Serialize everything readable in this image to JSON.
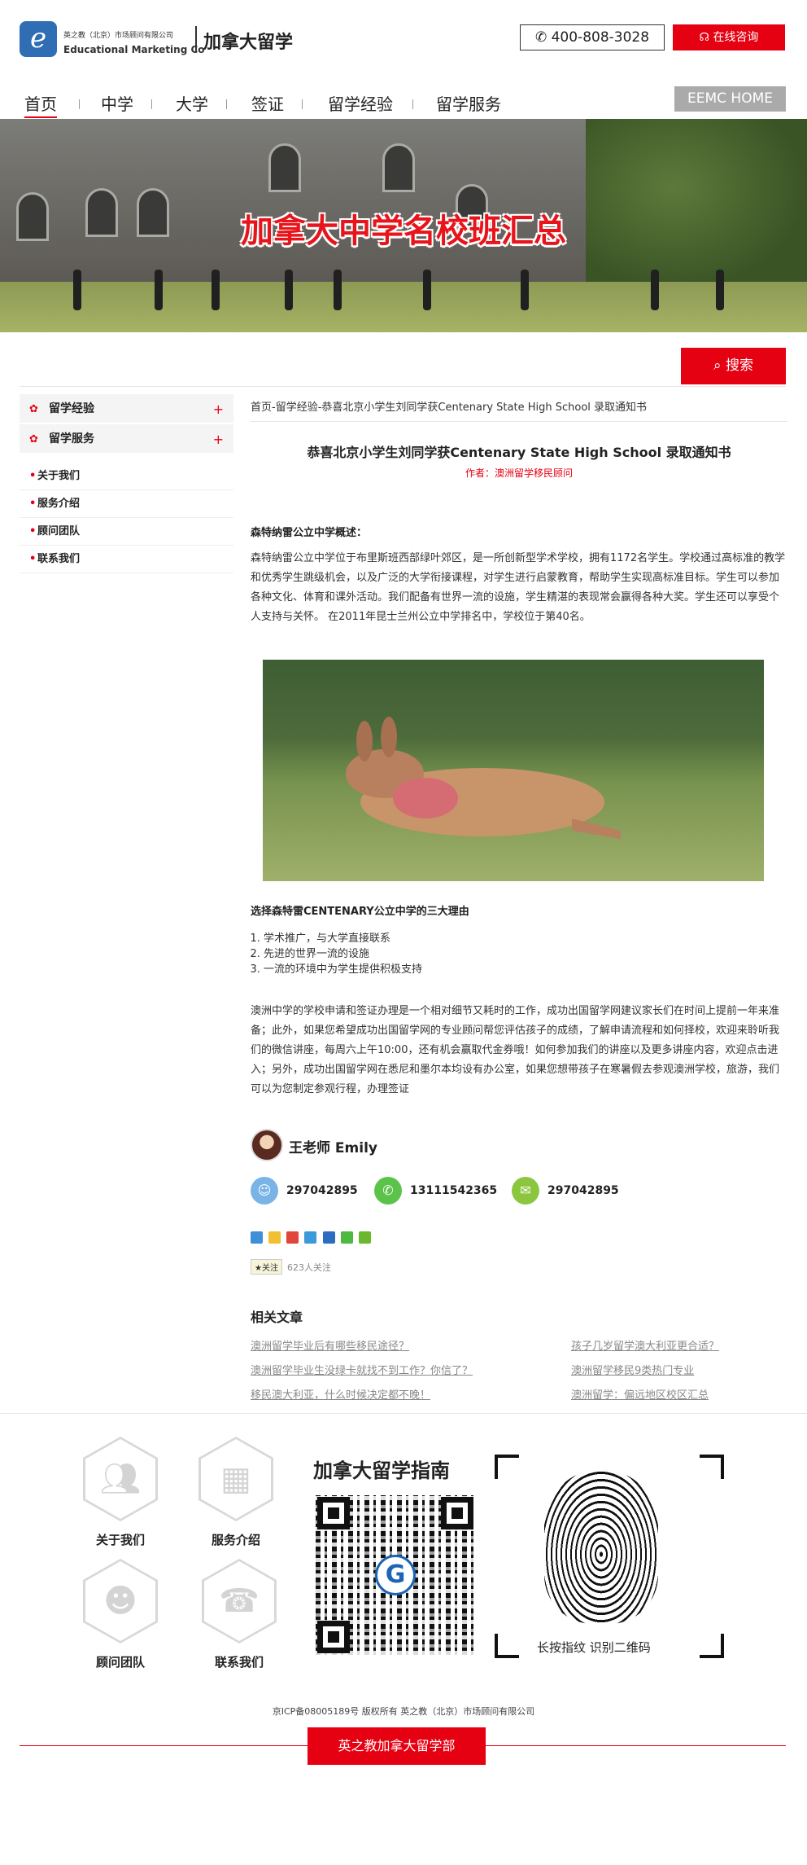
{
  "header": {
    "company_cn": "英之教（北京）市场顾问有限公司",
    "company_en": "Educational Marketing Co",
    "site_title": "加拿大留学",
    "phone": "400-808-3028",
    "consult_label": "在线咨询",
    "logo_letter": "e"
  },
  "nav": {
    "items": [
      "首页",
      "中学",
      "大学",
      "签证",
      "留学经验",
      "留学服务"
    ],
    "active_index": 0,
    "home_label": "EEMC HOME"
  },
  "banner": {
    "title": "加拿大中学名校班汇总"
  },
  "search": {
    "button_label": "搜索"
  },
  "sidebar": {
    "sections": [
      {
        "label": "留学经验",
        "expand": "+"
      },
      {
        "label": "留学服务",
        "expand": "+"
      }
    ],
    "links": [
      "关于我们",
      "服务介绍",
      "顾问团队",
      "联系我们"
    ]
  },
  "article": {
    "breadcrumb": "首页-留学经验-恭喜北京小学生刘同学获Centenary State High School 录取通知书",
    "title": "恭喜北京小学生刘同学获Centenary State High School 录取通知书",
    "author": "作者：澳洲留学移民顾问",
    "overview_heading": "森特纳雷公立中学概述：",
    "overview_text": "森特纳雷公立中学位于布里斯班西部绿叶郊区，是一所创新型学术学校，拥有1172名学生。学校通过高标准的教学和优秀学生跳级机会，以及广泛的大学衔接课程，对学生进行启蒙教育，帮助学生实现高标准目标。学生可以参加各种文化、体育和课外活动。我们配备有世界一流的设施，学生精湛的表现常会赢得各种大奖。学生还可以享受个人支持与关怀。 在2011年昆士兰州公立中学排名中，学校位于第40名。",
    "reasons_heading": "选择森特雷CENTENARY公立中学的三大理由",
    "reasons": [
      "学术推广，与大学直接联系",
      "先进的世界一流的设施",
      "一流的环境中为学生提供积极支持"
    ],
    "closing_text": "澳洲中学的学校申请和签证办理是一个相对细节又耗时的工作，成功出国留学网建议家长们在时间上提前一年来准备；此外，如果您希望成功出国留学网的专业顾问帮您评估孩子的成绩，了解申请流程和如何择校，欢迎来聆听我们的微信讲座，每周六上午10:00，还有机会赢取代金券哦！如何参加我们的讲座以及更多讲座内容，欢迎点击进入；另外，成功出国留学网在悉尼和墨尔本均设有办公室，如果您想带孩子在寒暑假去参观澳洲学校，旅游，我们可以为您制定参观行程，办理签证"
  },
  "teacher": {
    "name": "王老师 Emily",
    "qq": "297042895",
    "whatsapp": "13111542365",
    "wechat": "297042895"
  },
  "follow": {
    "button_label": "关注",
    "count_text": "623人关注"
  },
  "related": {
    "heading": "相关文章",
    "left": [
      "澳洲留学毕业后有哪些移民途径？",
      "澳洲留学毕业生没绿卡就找不到工作？你信了？",
      "移民澳大利亚，什么时候决定都不晚！"
    ],
    "right": [
      "孩子几岁留学澳大利亚更合适？",
      "澳洲留学移民9类热门专业",
      "澳洲留学：偏远地区校区汇总"
    ]
  },
  "footer": {
    "tiles": [
      "关于我们",
      "服务介绍",
      "顾问团队",
      "联系我们"
    ],
    "guide_title": "加拿大留学指南",
    "fingerprint_label": "长按指纹 识别二维码",
    "qr_logo_letter": "G",
    "icp": "京ICP备08005189号 版权所有 英之教（北京）市场顾问有限公司",
    "bottom_label": "英之教加拿大留学部"
  },
  "colors": {
    "accent": "#e50012",
    "brand_blue": "#2f6db5",
    "qq": "#7ab3e6",
    "whatsapp": "#5cc34a",
    "wechat": "#8cc63f"
  }
}
